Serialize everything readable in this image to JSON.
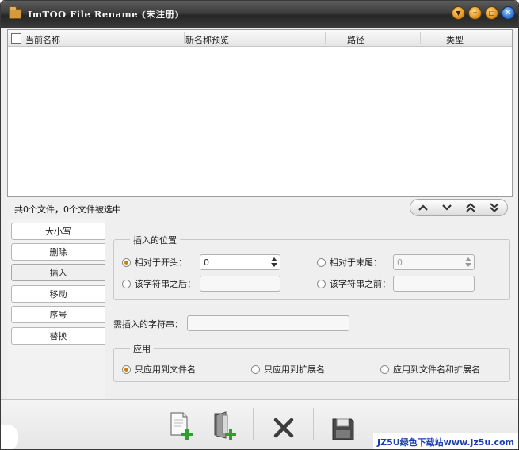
{
  "window": {
    "title": "ImTOO File Rename (未注册)",
    "controls": {
      "minimize_to_tray_glyph": "▼",
      "minimize_glyph": "━",
      "maximize_glyph": "□",
      "close_glyph": "✕"
    }
  },
  "file_list": {
    "columns": [
      "当前名称",
      "新名称预览",
      "路径",
      "类型"
    ],
    "rows": []
  },
  "status": {
    "text": "共0个文件，0个文件被选中"
  },
  "nav_buttons": {
    "up": "⌃",
    "down": "⌄",
    "top": "⏶",
    "bottom": "⏷"
  },
  "tabs": [
    {
      "label": "大小写",
      "active": false
    },
    {
      "label": "删除",
      "active": false
    },
    {
      "label": "插入",
      "active": true
    },
    {
      "label": "移动",
      "active": false
    },
    {
      "label": "序号",
      "active": false
    },
    {
      "label": "替换",
      "active": false
    }
  ],
  "insert_position": {
    "title": "插入的位置",
    "from_start": {
      "label": "相对于开头：",
      "value": "0",
      "checked": true
    },
    "from_end": {
      "label": "相对于末尾：",
      "value": "0",
      "checked": false
    },
    "after_string": {
      "label": "该字符串之后：",
      "value": "",
      "checked": false
    },
    "before_string": {
      "label": "该字符串之前：",
      "value": "",
      "checked": false
    }
  },
  "insert_string": {
    "label": "需插入的字符串：",
    "value": ""
  },
  "apply": {
    "title": "应用",
    "options": [
      {
        "label": "只应用到文件名",
        "checked": true
      },
      {
        "label": "只应用到扩展名",
        "checked": false
      },
      {
        "label": "应用到文件名和扩展名",
        "checked": false
      }
    ]
  },
  "colors": {
    "accent_orange": "#d77b10",
    "icon_green": "#2e9e2e",
    "titlebar_dark": "#2f2f2f",
    "watermark_blue": "#1b3fb0"
  },
  "toolbar": {
    "buttons": [
      "add-file-icon",
      "add-folder-icon",
      "delete-icon",
      "save-icon"
    ]
  },
  "watermark": {
    "text": "JZ5U绿色下载站www.jz5u.com"
  }
}
